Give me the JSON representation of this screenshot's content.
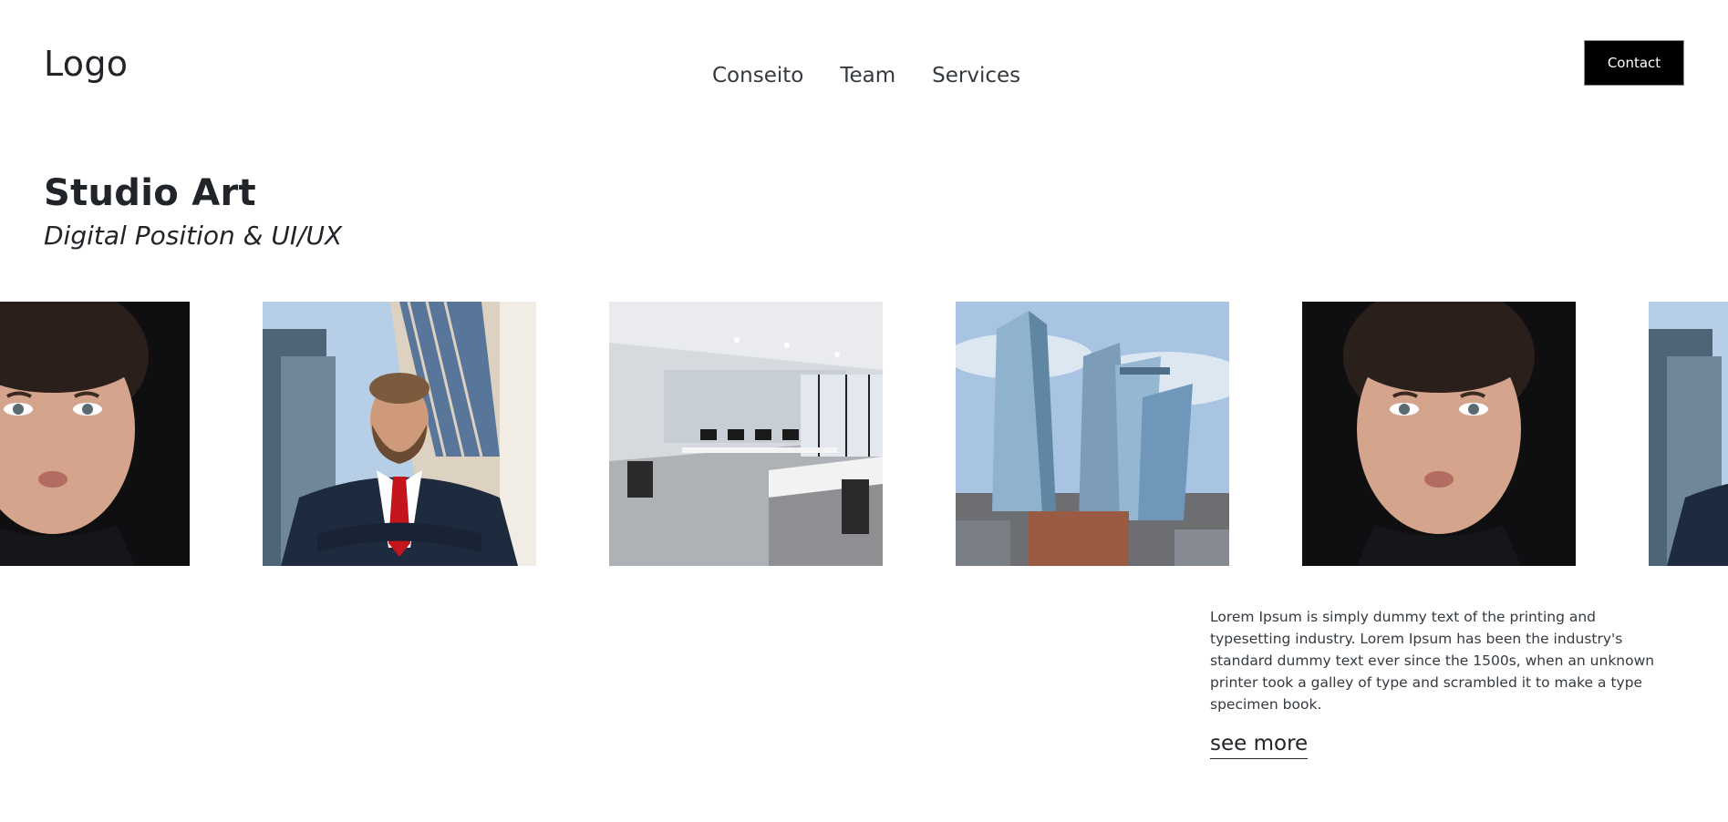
{
  "header": {
    "logo": "Logo",
    "nav": [
      "Conseito",
      "Team",
      "Services"
    ],
    "contact_label": "Contact"
  },
  "hero": {
    "title": "Studio Art",
    "subtitle": "Digital Position & UI/UX"
  },
  "gallery": {
    "images": [
      "woman-portrait-image",
      "businessman-image",
      "office-interior-image",
      "skyscrapers-image",
      "woman-portrait-image",
      "businessman-image"
    ]
  },
  "content": {
    "description": "Lorem Ipsum is simply dummy text of the printing and typesetting industry. Lorem Ipsum has been the industry's standard dummy text ever since the 1500s, when an unknown printer took a galley of type and scrambled it to make a type specimen book.",
    "see_more": "see more"
  },
  "colors": {
    "button_bg": "#000000",
    "button_text": "#ffffff",
    "text": "#212529"
  }
}
